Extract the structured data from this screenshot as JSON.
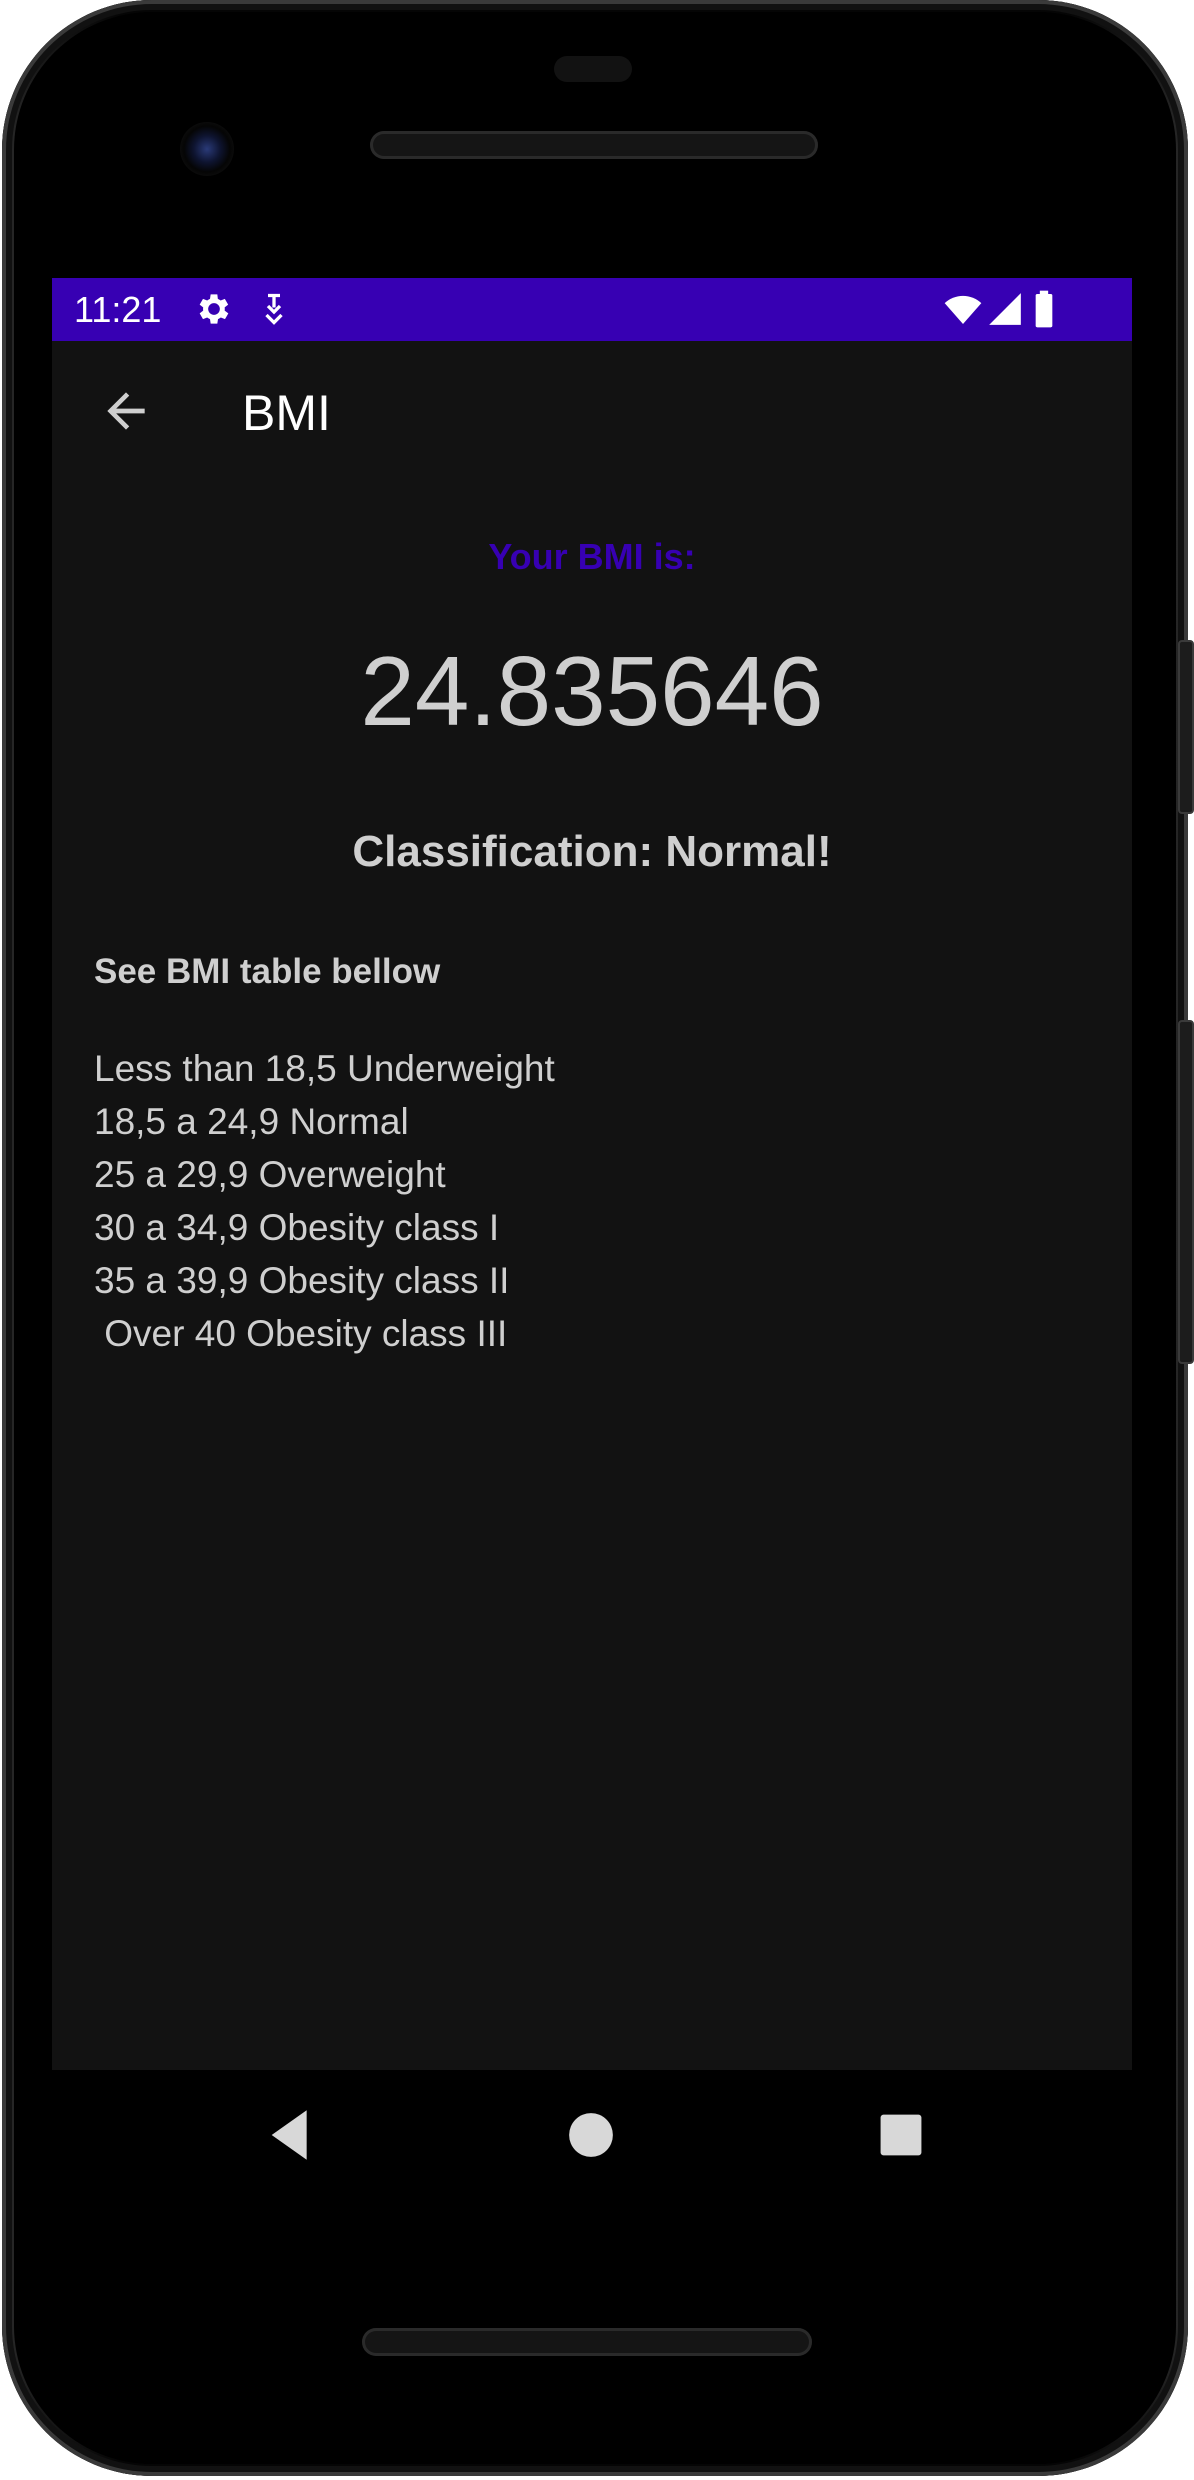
{
  "status_bar": {
    "time": "11:21",
    "icons": [
      "gear-icon",
      "download-icon",
      "wifi-icon",
      "cellular-signal-icon",
      "battery-icon"
    ],
    "background": "#3700b3"
  },
  "app_bar": {
    "title": "BMI",
    "back_icon": "arrow-back-icon"
  },
  "result": {
    "label": "Your BMI is:",
    "label_color": "#3700b3",
    "value": "24.835646",
    "classification": "Classification: Normal!"
  },
  "bmi_table": {
    "heading": "See BMI table bellow",
    "rows": [
      "Less than 18,5 Underweight",
      "18,5 a 24,9 Normal",
      "25 a 29,9 Overweight",
      "30 a 34,9 Obesity class I",
      "35 a 39,9 Obesity class II",
      " Over 40 Obesity class III"
    ]
  },
  "navigation": {
    "buttons": [
      "back-triangle-icon",
      "home-circle-icon",
      "recents-square-icon"
    ]
  },
  "colors": {
    "screen_background": "#121212",
    "text": "#cfcfcf",
    "accent": "#3700b3"
  }
}
